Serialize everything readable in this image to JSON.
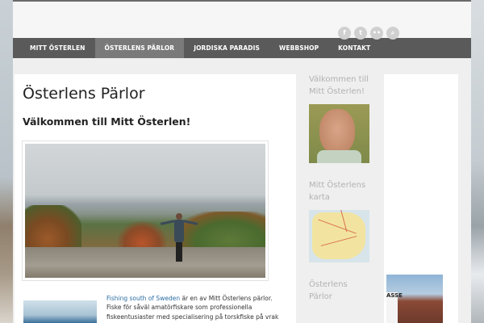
{
  "header": {
    "social_icons": [
      {
        "name": "facebook-icon",
        "glyph": "f"
      },
      {
        "name": "twitter-icon",
        "glyph": "t"
      },
      {
        "name": "flickr-icon",
        "glyph": "••"
      },
      {
        "name": "search-icon",
        "glyph": "⌕"
      }
    ]
  },
  "nav": {
    "items": [
      {
        "label": "MITT ÖSTERLEN",
        "active": false
      },
      {
        "label": "ÖSTERLENS PÄRLOR",
        "active": true
      },
      {
        "label": "JORDISKA PARADIS",
        "active": false
      },
      {
        "label": "WEBBSHOP",
        "active": false
      },
      {
        "label": "KONTAKT",
        "active": false
      }
    ]
  },
  "main": {
    "title": "Österlens Pärlor",
    "welcome": "Välkommen till Mitt Österlen!",
    "article": {
      "link_text": "Fishing south of Sweden",
      "body": " är en av Mitt Österlens pärlor. Fiske för såväl amatörfiskare som professionella fiskeentusiaster med specialisering på torskfiske på vrak och stenryggar som"
    }
  },
  "sidebar": {
    "widgets": [
      {
        "title": "Välkommen till Mitt Österlen!"
      },
      {
        "title": "Mitt Österlens karta"
      },
      {
        "title": "Österlens Pärlor"
      }
    ]
  },
  "right_column": {
    "photo_sign_text": "ASSE"
  },
  "colors": {
    "nav_bg": "#5a5a5a",
    "nav_active": "#7a7a7a",
    "link": "#2b6da3",
    "widget_title": "#b2b2b2"
  }
}
